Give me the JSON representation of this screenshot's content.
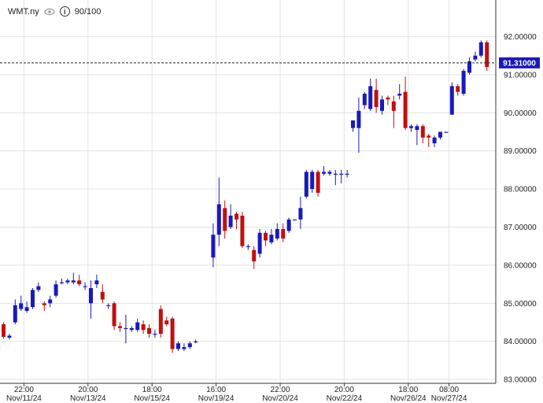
{
  "header": {
    "symbol": "WMT.ny",
    "count_label": "90/100",
    "eye_icon": "eye-icon",
    "info_icon": "info-icon"
  },
  "colors": {
    "up": "#1a1ab8",
    "down": "#c01010",
    "grid": "#e3e3e3",
    "price_tag_bg": "#1a1ab8",
    "text": "#222222"
  },
  "chart_data": {
    "type": "candlestick",
    "title": "",
    "xlabel": "",
    "ylabel": "",
    "ylim": [
      82.9,
      92.96
    ],
    "y_ticks": [
      "83.00000",
      "84.00000",
      "85.00000",
      "86.00000",
      "87.00000",
      "88.00000",
      "89.00000",
      "90.00000",
      "91.00000",
      "92.00000"
    ],
    "x_ticks": [
      {
        "time": "22:00",
        "date": "Nov/11/24"
      },
      {
        "time": "20:00",
        "date": "Nov/13/24"
      },
      {
        "time": "18:00",
        "date": "Nov/15/24"
      },
      {
        "time": "16:00",
        "date": "Nov/19/24"
      },
      {
        "time": "22:00",
        "date": "Nov/20/24"
      },
      {
        "time": "20:00",
        "date": "Nov/22/24"
      },
      {
        "time": "18:00",
        "date": "Nov/26/24"
      },
      {
        "time": "08:00",
        "date": "Nov/27/24"
      }
    ],
    "x_tick_slots": [
      3.5,
      14.5,
      25.5,
      36.5,
      47.5,
      58.5,
      69.5,
      76.5
    ],
    "current_price": "91.31000",
    "current_price_value": 91.31,
    "candles": [
      [
        84.45,
        84.12,
        84.5,
        84.08
      ],
      [
        84.1,
        84.15,
        84.2,
        84.05
      ],
      [
        84.5,
        84.95,
        85.1,
        84.45
      ],
      [
        84.85,
        85.0,
        85.2,
        84.8
      ],
      [
        84.8,
        84.9,
        85.05,
        84.75
      ],
      [
        84.9,
        85.35,
        85.4,
        84.85
      ],
      [
        85.35,
        85.45,
        85.55,
        85.3
      ],
      [
        85.0,
        84.95,
        85.05,
        84.8
      ],
      [
        85.0,
        85.1,
        85.2,
        84.9
      ],
      [
        85.2,
        85.5,
        85.6,
        85.15
      ],
      [
        85.55,
        85.55,
        85.65,
        85.5
      ],
      [
        85.55,
        85.6,
        85.65,
        85.5
      ],
      [
        85.55,
        85.6,
        85.8,
        85.5
      ],
      [
        85.6,
        85.5,
        85.75,
        85.45
      ],
      [
        85.45,
        85.45,
        85.55,
        85.35
      ],
      [
        85.0,
        85.4,
        85.6,
        84.6
      ],
      [
        85.5,
        85.6,
        85.75,
        85.4
      ],
      [
        85.3,
        85.1,
        85.5,
        85.0
      ],
      [
        84.95,
        84.95,
        85.0,
        84.85
      ],
      [
        85.0,
        84.4,
        85.05,
        84.3
      ],
      [
        84.4,
        84.35,
        84.5,
        84.25
      ],
      [
        84.35,
        84.35,
        84.7,
        83.95
      ],
      [
        84.3,
        84.35,
        84.4,
        84.25
      ],
      [
        84.3,
        84.5,
        84.6,
        84.25
      ],
      [
        84.45,
        84.3,
        84.55,
        84.2
      ],
      [
        84.35,
        84.2,
        84.45,
        84.1
      ],
      [
        84.2,
        84.2,
        84.3,
        84.1
      ],
      [
        84.85,
        84.2,
        84.95,
        84.1
      ],
      [
        84.55,
        84.45,
        84.65,
        84.4
      ],
      [
        84.6,
        83.8,
        84.65,
        83.7
      ],
      [
        83.8,
        83.95,
        84.0,
        83.75
      ],
      [
        83.8,
        83.85,
        83.95,
        83.75
      ],
      [
        83.85,
        83.95,
        84.0,
        83.8
      ],
      [
        84.0,
        84.0,
        84.05,
        83.95
      ],
      [
        85.0,
        85.0,
        85.0,
        85.0
      ],
      [
        85.0,
        85.0,
        85.0,
        85.0
      ],
      [
        86.2,
        86.8,
        87.1,
        85.95
      ],
      [
        86.8,
        87.6,
        88.3,
        86.5
      ],
      [
        87.5,
        86.9,
        87.7,
        86.7
      ],
      [
        87.0,
        87.3,
        87.6,
        86.95
      ],
      [
        87.35,
        87.2,
        87.4,
        86.95
      ],
      [
        87.3,
        86.5,
        87.4,
        86.45
      ],
      [
        86.5,
        86.5,
        86.55,
        86.4
      ],
      [
        86.4,
        86.1,
        86.5,
        85.9
      ],
      [
        86.3,
        86.85,
        86.95,
        86.2
      ],
      [
        86.85,
        86.65,
        86.9,
        86.5
      ],
      [
        86.6,
        86.8,
        86.95,
        86.55
      ],
      [
        86.7,
        86.95,
        87.1,
        86.65
      ],
      [
        86.95,
        86.7,
        87.1,
        86.6
      ],
      [
        86.9,
        87.2,
        87.25,
        86.85
      ],
      [
        87.2,
        87.2,
        87.2,
        87.2
      ],
      [
        87.2,
        87.5,
        87.8,
        86.95
      ],
      [
        87.8,
        88.45,
        88.5,
        87.75
      ],
      [
        88.0,
        88.45,
        88.5,
        87.9
      ],
      [
        88.45,
        87.9,
        88.5,
        87.8
      ],
      [
        88.4,
        88.45,
        88.6,
        88.35
      ],
      [
        88.4,
        88.45,
        88.5,
        88.35
      ],
      [
        88.4,
        88.4,
        88.5,
        88.1
      ],
      [
        88.4,
        88.4,
        88.5,
        88.15
      ],
      [
        88.4,
        88.4,
        88.5,
        88.3
      ],
      [
        89.6,
        89.8,
        89.8,
        89.5
      ],
      [
        89.6,
        90.05,
        90.4,
        88.95
      ],
      [
        90.2,
        90.5,
        90.55,
        90.1
      ],
      [
        90.1,
        90.7,
        90.9,
        90.05
      ],
      [
        90.6,
        90.15,
        90.9,
        90.0
      ],
      [
        90.05,
        90.35,
        90.45,
        89.95
      ],
      [
        90.4,
        90.35,
        90.45,
        90.2
      ],
      [
        90.3,
        90.05,
        90.45,
        89.6
      ],
      [
        90.45,
        90.5,
        90.75,
        90.35
      ],
      [
        90.55,
        89.6,
        90.95,
        89.55
      ],
      [
        89.6,
        89.65,
        89.7,
        89.5
      ],
      [
        89.55,
        89.65,
        89.7,
        89.15
      ],
      [
        89.65,
        89.35,
        89.7,
        89.2
      ],
      [
        89.4,
        89.35,
        89.45,
        89.1
      ],
      [
        89.2,
        89.35,
        89.4,
        89.1
      ],
      [
        89.35,
        89.5,
        89.5,
        89.3
      ],
      [
        89.5,
        89.5,
        89.5,
        89.5
      ],
      [
        89.95,
        90.7,
        90.8,
        89.95
      ],
      [
        90.7,
        90.55,
        90.75,
        90.45
      ],
      [
        90.5,
        91.1,
        91.15,
        90.45
      ],
      [
        91.05,
        91.35,
        91.45,
        91.0
      ],
      [
        91.4,
        91.5,
        91.6,
        91.35
      ],
      [
        91.5,
        91.85,
        91.9,
        91.45
      ],
      [
        91.85,
        91.2,
        91.9,
        91.1
      ]
    ]
  }
}
